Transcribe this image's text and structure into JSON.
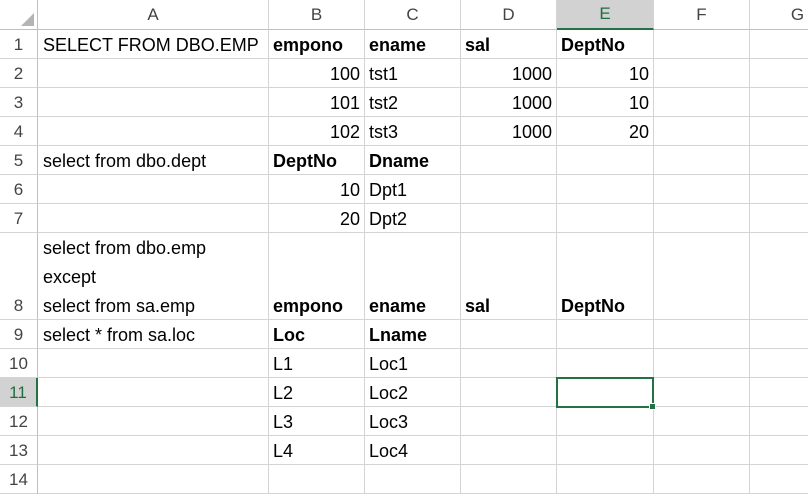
{
  "columns": [
    "A",
    "B",
    "C",
    "D",
    "E",
    "F",
    "G"
  ],
  "rows": [
    "1",
    "2",
    "3",
    "4",
    "5",
    "6",
    "7",
    "8",
    "9",
    "10",
    "11",
    "12",
    "13",
    "14"
  ],
  "selected_cell": "E11",
  "cells": {
    "A1": "SELECT FROM DBO.EMP",
    "B1": "empono",
    "C1": "ename",
    "D1": "sal",
    "E1": "DeptNo",
    "B2": "100",
    "C2": "tst1",
    "D2": "1000",
    "E2": "10",
    "B3": "101",
    "C3": "tst2",
    "D3": "1000",
    "E3": "10",
    "B4": "102",
    "C4": "tst3",
    "D4": "1000",
    "E4": "20",
    "A5": "select from dbo.dept",
    "B5": "DeptNo",
    "C5": "Dname",
    "B6": "10",
    "C6": "Dpt1",
    "B7": "20",
    "C7": "Dpt2",
    "A8_line1": "select from dbo.emp",
    "A8_line2": "except",
    "A8_line3": "select from sa.emp",
    "B8": "empono",
    "C8": "ename",
    "D8": "sal",
    "E8": "DeptNo",
    "A9": "select * from sa.loc",
    "B9": "Loc",
    "C9": "Lname",
    "B10": "L1",
    "C10": "Loc1",
    "B11": "L2",
    "C11": "Loc2",
    "B12": "L3",
    "C12": "Loc3",
    "B13": "L4",
    "C13": "Loc4"
  },
  "colors": {
    "accent": "#217346",
    "header_active_bg": "#d2d2d2",
    "gridline": "#d4d4d4"
  }
}
